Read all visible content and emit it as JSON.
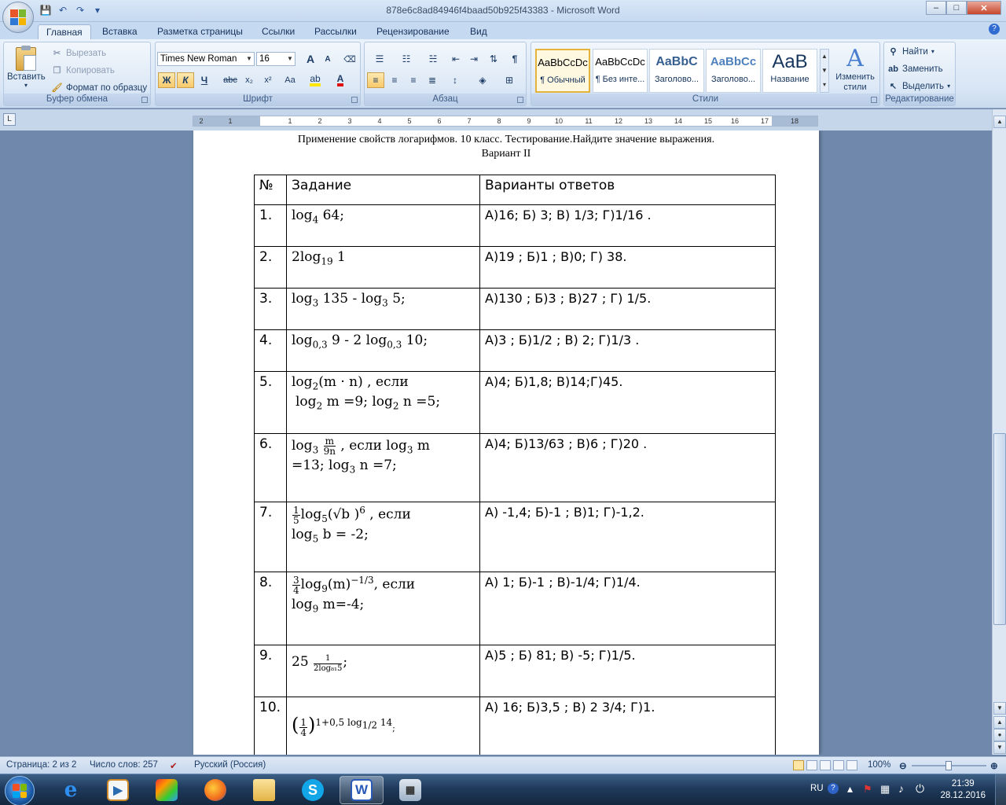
{
  "window": {
    "title": "878e6c8ad84946f4baad50b925f43383 - Microsoft Word",
    "minimize": "–",
    "maximize": "□",
    "close": "✕"
  },
  "qat": {
    "save_icon": "💾",
    "undo_icon": "↶",
    "redo_icon": "↷",
    "more_icon": "▾"
  },
  "tabs": [
    "Главная",
    "Вставка",
    "Разметка страницы",
    "Ссылки",
    "Рассылки",
    "Рецензирование",
    "Вид"
  ],
  "ribbon": {
    "clipboard": {
      "label": "Буфер обмена",
      "paste": "Вставить",
      "cut": "Вырезать",
      "copy": "Копировать",
      "format_painter": "Формат по образцу"
    },
    "font": {
      "label": "Шрифт",
      "family": "Times New Roman",
      "size": "16",
      "bold": "Ж",
      "italic": "К",
      "underline": "Ч",
      "strike": "abc",
      "subscript": "x₂",
      "superscript": "x²",
      "case": "Aa",
      "grow": "A",
      "shrink": "A"
    },
    "paragraph": {
      "label": "Абзац",
      "pilcrow": "¶"
    },
    "styles": {
      "label": "Стили",
      "items": [
        {
          "sample": "AaBbCcDc",
          "name": "¶ Обычный"
        },
        {
          "sample": "AaBbCcDc",
          "name": "¶ Без инте..."
        },
        {
          "sample": "AaBbC",
          "name": "Заголово..."
        },
        {
          "sample": "AaBbCc",
          "name": "Заголово..."
        },
        {
          "sample": "AaB",
          "name": "Название"
        }
      ],
      "change": "Изменить стили"
    },
    "editing": {
      "label": "Редактирование",
      "find": "Найти",
      "replace": "Заменить",
      "select": "Выделить"
    }
  },
  "ruler": {
    "corner": "L",
    "numbers": [
      "2",
      "1",
      "1",
      "2",
      "3",
      "4",
      "5",
      "6",
      "7",
      "8",
      "9",
      "10",
      "11",
      "12",
      "13",
      "14",
      "15",
      "16",
      "17",
      "18"
    ]
  },
  "document": {
    "title": "Применение свойств логарифмов. 10 класс. Тестирование.Найдите значение выражения.",
    "variant": "Вариант II",
    "headers": [
      "№",
      "Задание",
      "Варианты ответов"
    ],
    "rows": [
      {
        "n": "1.",
        "answers": "А)16;      Б) 3;       В) 1/3;        Г)1/16 ."
      },
      {
        "n": "2.",
        "answers": "А)19 ;      Б)1 ;     В)0;      Г) 38."
      },
      {
        "n": "3.",
        "answers": "А)130 ;       Б)3 ;      В)27 ;        Г) 1/5."
      },
      {
        "n": "4.",
        "answers": "А)3 ;      Б)1/2 ;        В) 2;        Г)1/3 ."
      },
      {
        "n": "5.",
        "answers": "А)4;     Б)1,8;        В)14;Г)45."
      },
      {
        "n": "6.",
        "answers": "А)4;       Б)13/63 ;       В)6 ;         Г)20 ."
      },
      {
        "n": "7.",
        "answers": "А) -1,4;       Б)-1 ;       В)1;       Г)-1,2."
      },
      {
        "n": "8.",
        "answers": "А) 1;       Б)-1 ;       В)-1/4;        Г)1/4."
      },
      {
        "n": "9.",
        "answers": "А)5 ;       Б) 81;       В) -5;         Г)1/5."
      },
      {
        "n": "10.",
        "answers": "А) 16;      Б)3,5 ;       В) 2 3/4;        Г)1."
      }
    ],
    "tasks": {
      "t1": {
        "a": "log",
        "b": "4",
        "c": " 64;"
      },
      "t2": {
        "a": "2log",
        "b": "19",
        "c": " 1"
      },
      "t3": {
        "a": "log",
        "b": "3",
        "c": " 135    - log",
        "d": "3",
        "e": " 5;"
      },
      "t4": {
        "a": "log",
        "b": "0,3",
        "c": " 9  - 2 log",
        "d": "0,3",
        "e": " 10;"
      },
      "t5": {
        "a": "log",
        "b": "2",
        "c": "(m · n)  ,  если",
        "d": "log",
        "e": "2",
        "f": " m =9;  log",
        "g": "2",
        "h": " n =5;"
      },
      "t6": {
        "a": "log",
        "b": "3",
        "num": "m",
        "den": "9n",
        "c": "  ,  если  log",
        "d": "3",
        "e": " m",
        "f": "=13;  log",
        "g": "3",
        "h": " n =7;"
      },
      "t7": {
        "num": "1",
        "den": "5",
        "a": "log",
        "b": "5",
        "c": "(√b )",
        "d": "6",
        "e": " , если",
        "f": "log",
        "g": "5",
        "h": " b = -2;"
      },
      "t8": {
        "num": "3",
        "den": "4",
        "a": "log",
        "b": "9",
        "c": "(m)",
        "d": "−1/3",
        "e": ", если",
        "f": "log",
        "g": "9",
        "h": " m=-4;"
      },
      "t9": {
        "a": "25",
        "num": "1",
        "den": "2log₈₁5",
        "c": ";"
      },
      "t10": {
        "num": "1",
        "den": "4",
        "a": "1+0,5 log",
        "b": "1/2",
        "c": " 14",
        "d": ";"
      }
    }
  },
  "status": {
    "page": "Страница: 2 из 2",
    "words": "Число слов: 257",
    "language": "Русский (Россия)",
    "zoom": "100%"
  },
  "taskbar": {
    "lang": "RU",
    "time": "21:39",
    "date": "28.12.2016"
  }
}
